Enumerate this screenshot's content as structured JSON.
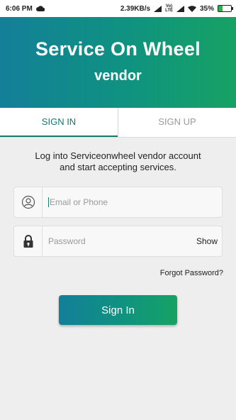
{
  "status_bar": {
    "time": "6:06 PM",
    "network_speed": "2.39KB/s",
    "lte_label_top": "Vo)",
    "lte_label_bottom": "LTE",
    "battery_percent": "35%",
    "battery_level": 0.35,
    "icons": [
      "cloud-icon",
      "signal-icon",
      "signal-icon",
      "wifi-icon",
      "battery-icon"
    ]
  },
  "header": {
    "title": "Service On Wheel",
    "subtitle": "vendor"
  },
  "tabs": [
    {
      "label": "SIGN IN",
      "active": true
    },
    {
      "label": "SIGN UP",
      "active": false
    }
  ],
  "description": {
    "line1": "Log into Serviceonwheel vendor account",
    "line2": "and start accepting services."
  },
  "form": {
    "email": {
      "value": "",
      "placeholder": "Email or Phone",
      "icon": "user-icon"
    },
    "password": {
      "value": "",
      "placeholder": "Password",
      "icon": "lock-icon",
      "toggle_label": "Show"
    },
    "forgot_label": "Forgot Password?",
    "submit_label": "Sign In"
  },
  "colors": {
    "gradient_start": "#137f98",
    "gradient_end": "#17a263",
    "tab_active": "#147a6e",
    "tab_inactive": "#9a9a9a"
  }
}
